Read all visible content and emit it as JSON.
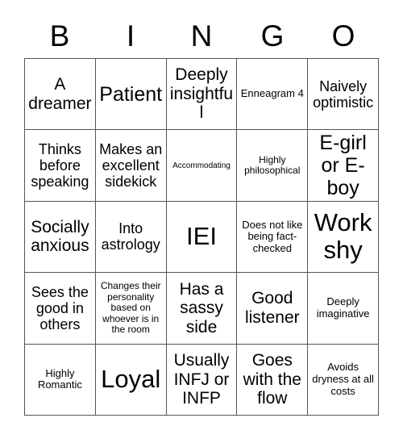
{
  "card": {
    "header_letters": [
      "B",
      "I",
      "N",
      "G",
      "O"
    ],
    "border_color": "#555555",
    "text_color": "#000000",
    "background_color": "#ffffff",
    "rows": [
      [
        {
          "text": "A dreamer",
          "size": "l"
        },
        {
          "text": "Patient",
          "size": "xl"
        },
        {
          "text": "Deeply insightful",
          "size": "l"
        },
        {
          "text": "Enneagram 4",
          "size": "s"
        },
        {
          "text": "Naively optimistic",
          "size": "m"
        }
      ],
      [
        {
          "text": "Thinks before speaking",
          "size": "m"
        },
        {
          "text": "Makes an excellent sidekick",
          "size": "m"
        },
        {
          "text": "Accommodating",
          "size": "xxs"
        },
        {
          "text": "Highly philosophical",
          "size": "xs"
        },
        {
          "text": "E-girl or E-boy",
          "size": "xl"
        }
      ],
      [
        {
          "text": "Socially anxious",
          "size": "l"
        },
        {
          "text": "Into astrology",
          "size": "m"
        },
        {
          "text": "IEI",
          "size": "xxl"
        },
        {
          "text": "Does not like being fact-checked",
          "size": "s"
        },
        {
          "text": "Work shy",
          "size": "xxl"
        }
      ],
      [
        {
          "text": "Sees the good in others",
          "size": "m"
        },
        {
          "text": "Changes their personality based on whoever is in the room",
          "size": "xs"
        },
        {
          "text": "Has a sassy side",
          "size": "l"
        },
        {
          "text": "Good listener",
          "size": "l"
        },
        {
          "text": "Deeply imaginative",
          "size": "s"
        }
      ],
      [
        {
          "text": "Highly Romantic",
          "size": "s"
        },
        {
          "text": "Loyal",
          "size": "xxl"
        },
        {
          "text": "Usually INFJ or INFP",
          "size": "l"
        },
        {
          "text": "Goes with the flow",
          "size": "l"
        },
        {
          "text": "Avoids dryness at all costs",
          "size": "s"
        }
      ]
    ]
  }
}
